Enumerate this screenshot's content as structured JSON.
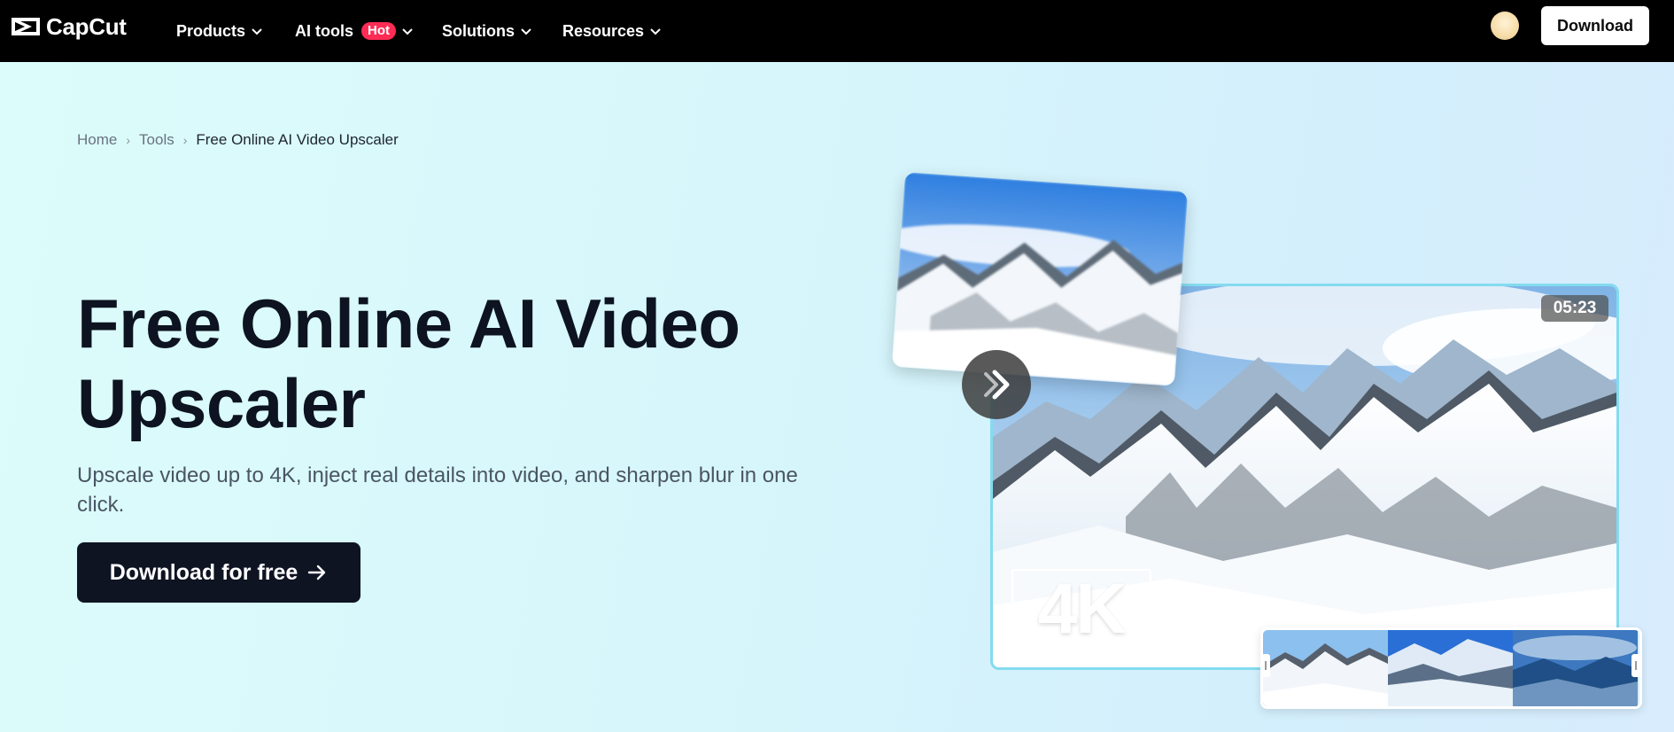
{
  "brand": {
    "name": "CapCut"
  },
  "nav": {
    "items": [
      {
        "label": "Products"
      },
      {
        "label": "AI tools",
        "badge": "Hot"
      },
      {
        "label": "Solutions"
      },
      {
        "label": "Resources"
      }
    ],
    "download_label": "Download"
  },
  "breadcrumb": {
    "home": "Home",
    "tools": "Tools",
    "current": "Free Online AI Video Upscaler"
  },
  "hero": {
    "title_line1": "Free Online AI Video",
    "title_line2": "Upscaler",
    "subtitle": "Upscale video up to 4K, inject real details into video, and sharpen blur in one click.",
    "cta_label": "Download for free"
  },
  "preview": {
    "duration": "05:23",
    "resolution_label": "4K"
  },
  "colors": {
    "nav_bg": "#000000",
    "cta_bg": "#0e1422",
    "hot_badge": "#fe2c55",
    "frame_border": "#84dbef"
  }
}
